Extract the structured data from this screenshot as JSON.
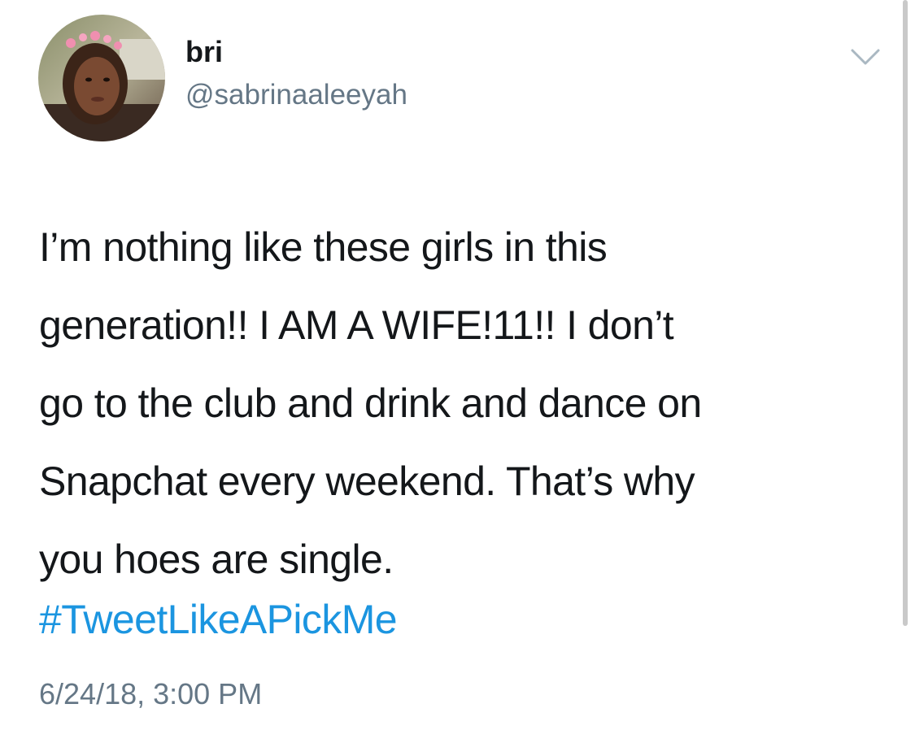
{
  "tweet": {
    "author": {
      "display_name": "bri",
      "handle": "@sabrinaaleeyah"
    },
    "text_lines": [
      "I’m nothing like these girls in this",
      "generation!! I AM A WIFE!11!! I don’t",
      "go to the club and drink and dance on",
      "Snapchat every weekend. That’s why",
      "you hoes are single."
    ],
    "hashtag": "#TweetLikeAPickMe",
    "timestamp": "6/24/18, 3:00 PM"
  },
  "icons": {
    "avatar": "profile-photo",
    "menu": "chevron-down-icon"
  },
  "colors": {
    "text": "#14171a",
    "secondary": "#657786",
    "link": "#1b95e0"
  }
}
